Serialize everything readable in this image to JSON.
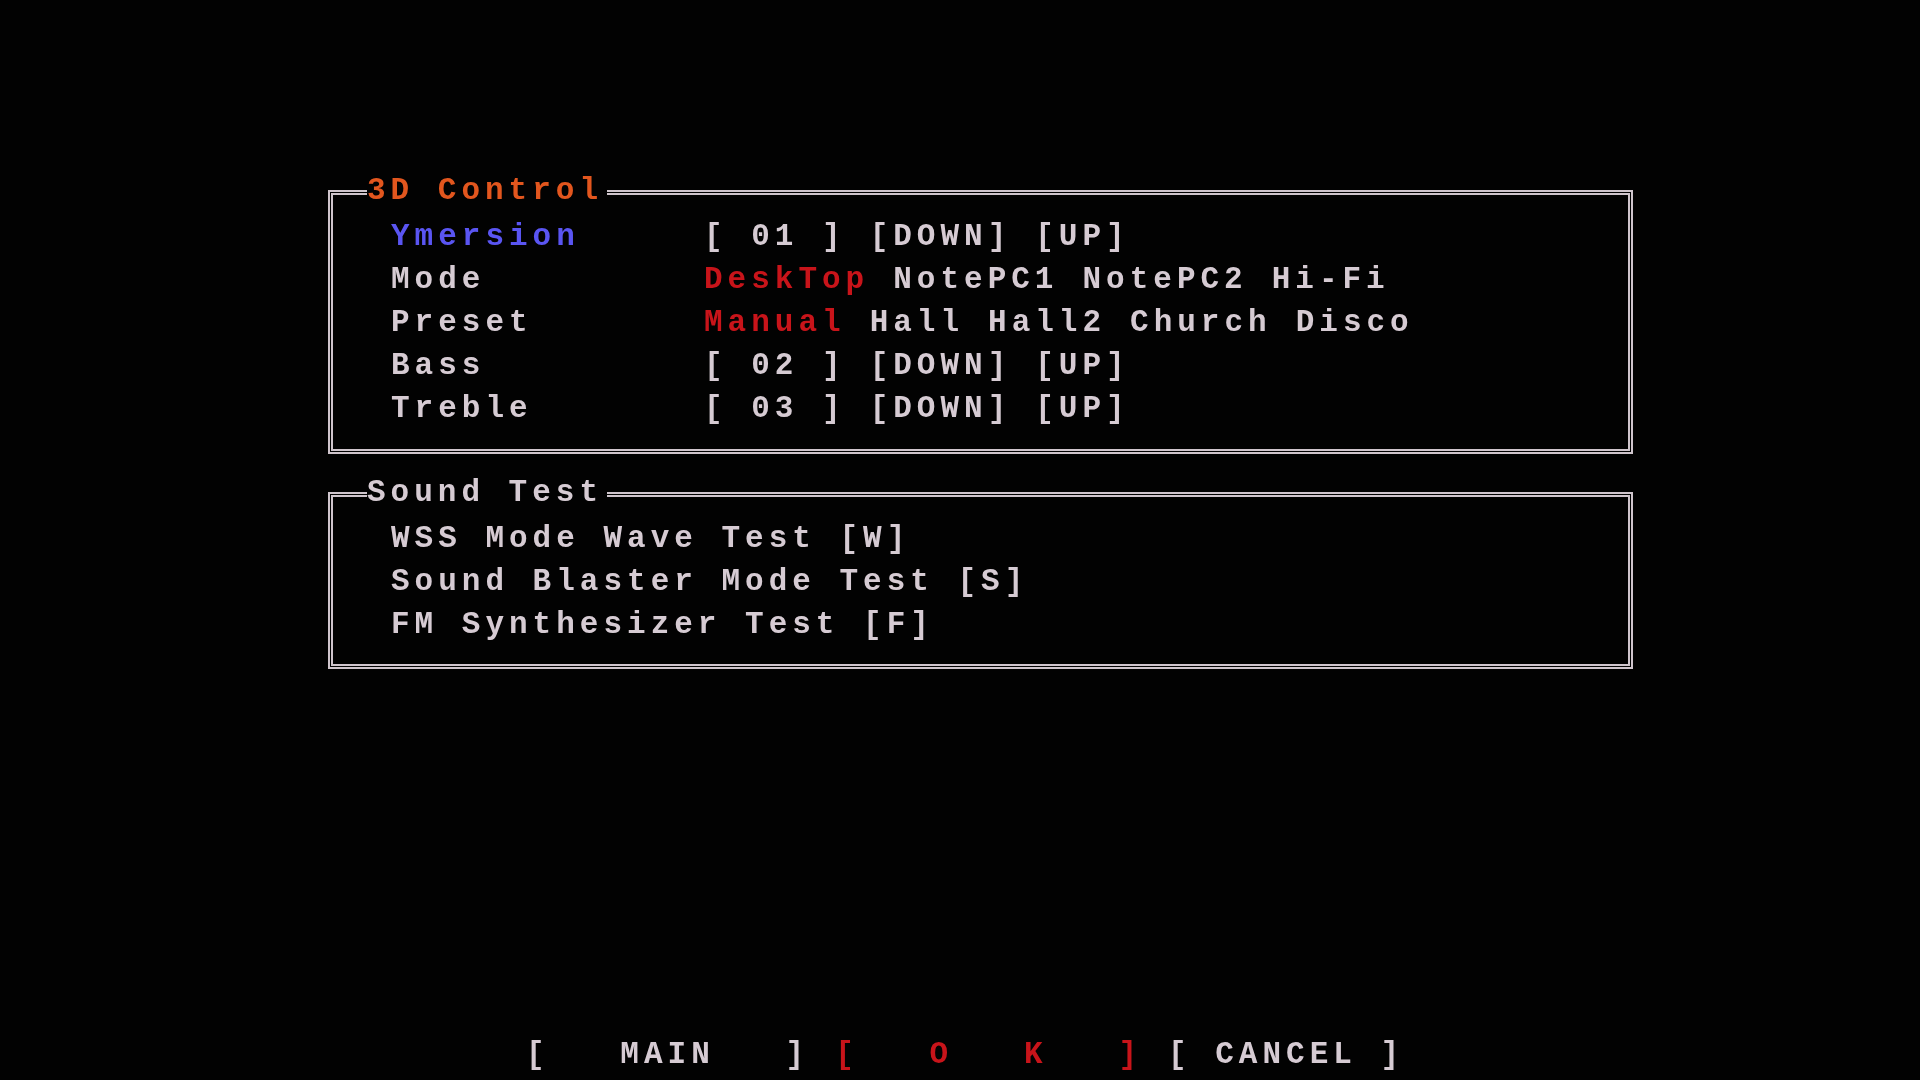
{
  "panels": [
    {
      "kind": "controls",
      "title": "3D Control",
      "rows": [
        {
          "kind": "stepper",
          "label": "Ymersion",
          "selected": true,
          "value": "[ 01 ]",
          "down": "[DOWN]",
          "up": "[UP]"
        },
        {
          "kind": "options",
          "label": "Mode",
          "selected": false,
          "options": [
            {
              "label": "DeskTop",
              "selected": true
            },
            {
              "label": "NotePC1",
              "selected": false
            },
            {
              "label": "NotePC2",
              "selected": false
            },
            {
              "label": "Hi-Fi",
              "selected": false
            }
          ]
        },
        {
          "kind": "options",
          "label": "Preset",
          "selected": false,
          "options": [
            {
              "label": "Manual",
              "selected": true
            },
            {
              "label": "Hall",
              "selected": false
            },
            {
              "label": "Hall2",
              "selected": false
            },
            {
              "label": "Church",
              "selected": false
            },
            {
              "label": "Disco",
              "selected": false
            }
          ]
        },
        {
          "kind": "stepper",
          "label": "Bass",
          "selected": false,
          "value": "[ 02 ]",
          "down": "[DOWN]",
          "up": "[UP]"
        },
        {
          "kind": "stepper",
          "label": "Treble",
          "selected": false,
          "value": "[ 03 ]",
          "down": "[DOWN]",
          "up": "[UP]"
        }
      ]
    },
    {
      "kind": "tests",
      "title": "Sound Test",
      "rows": [
        {
          "kind": "item",
          "label": "WSS Mode Wave Test [W]",
          "selected": false
        },
        {
          "kind": "item",
          "label": "Sound Blaster Mode Test [S]",
          "selected": false
        },
        {
          "kind": "item",
          "label": "FM Synthesizer Test [F]",
          "selected": false
        }
      ]
    }
  ],
  "buttons": [
    {
      "label": "[   MAIN   ]",
      "selected": false
    },
    {
      "label": "[   O   K   ]",
      "selected": true
    },
    {
      "label": "[ CANCEL ]",
      "selected": false
    }
  ]
}
